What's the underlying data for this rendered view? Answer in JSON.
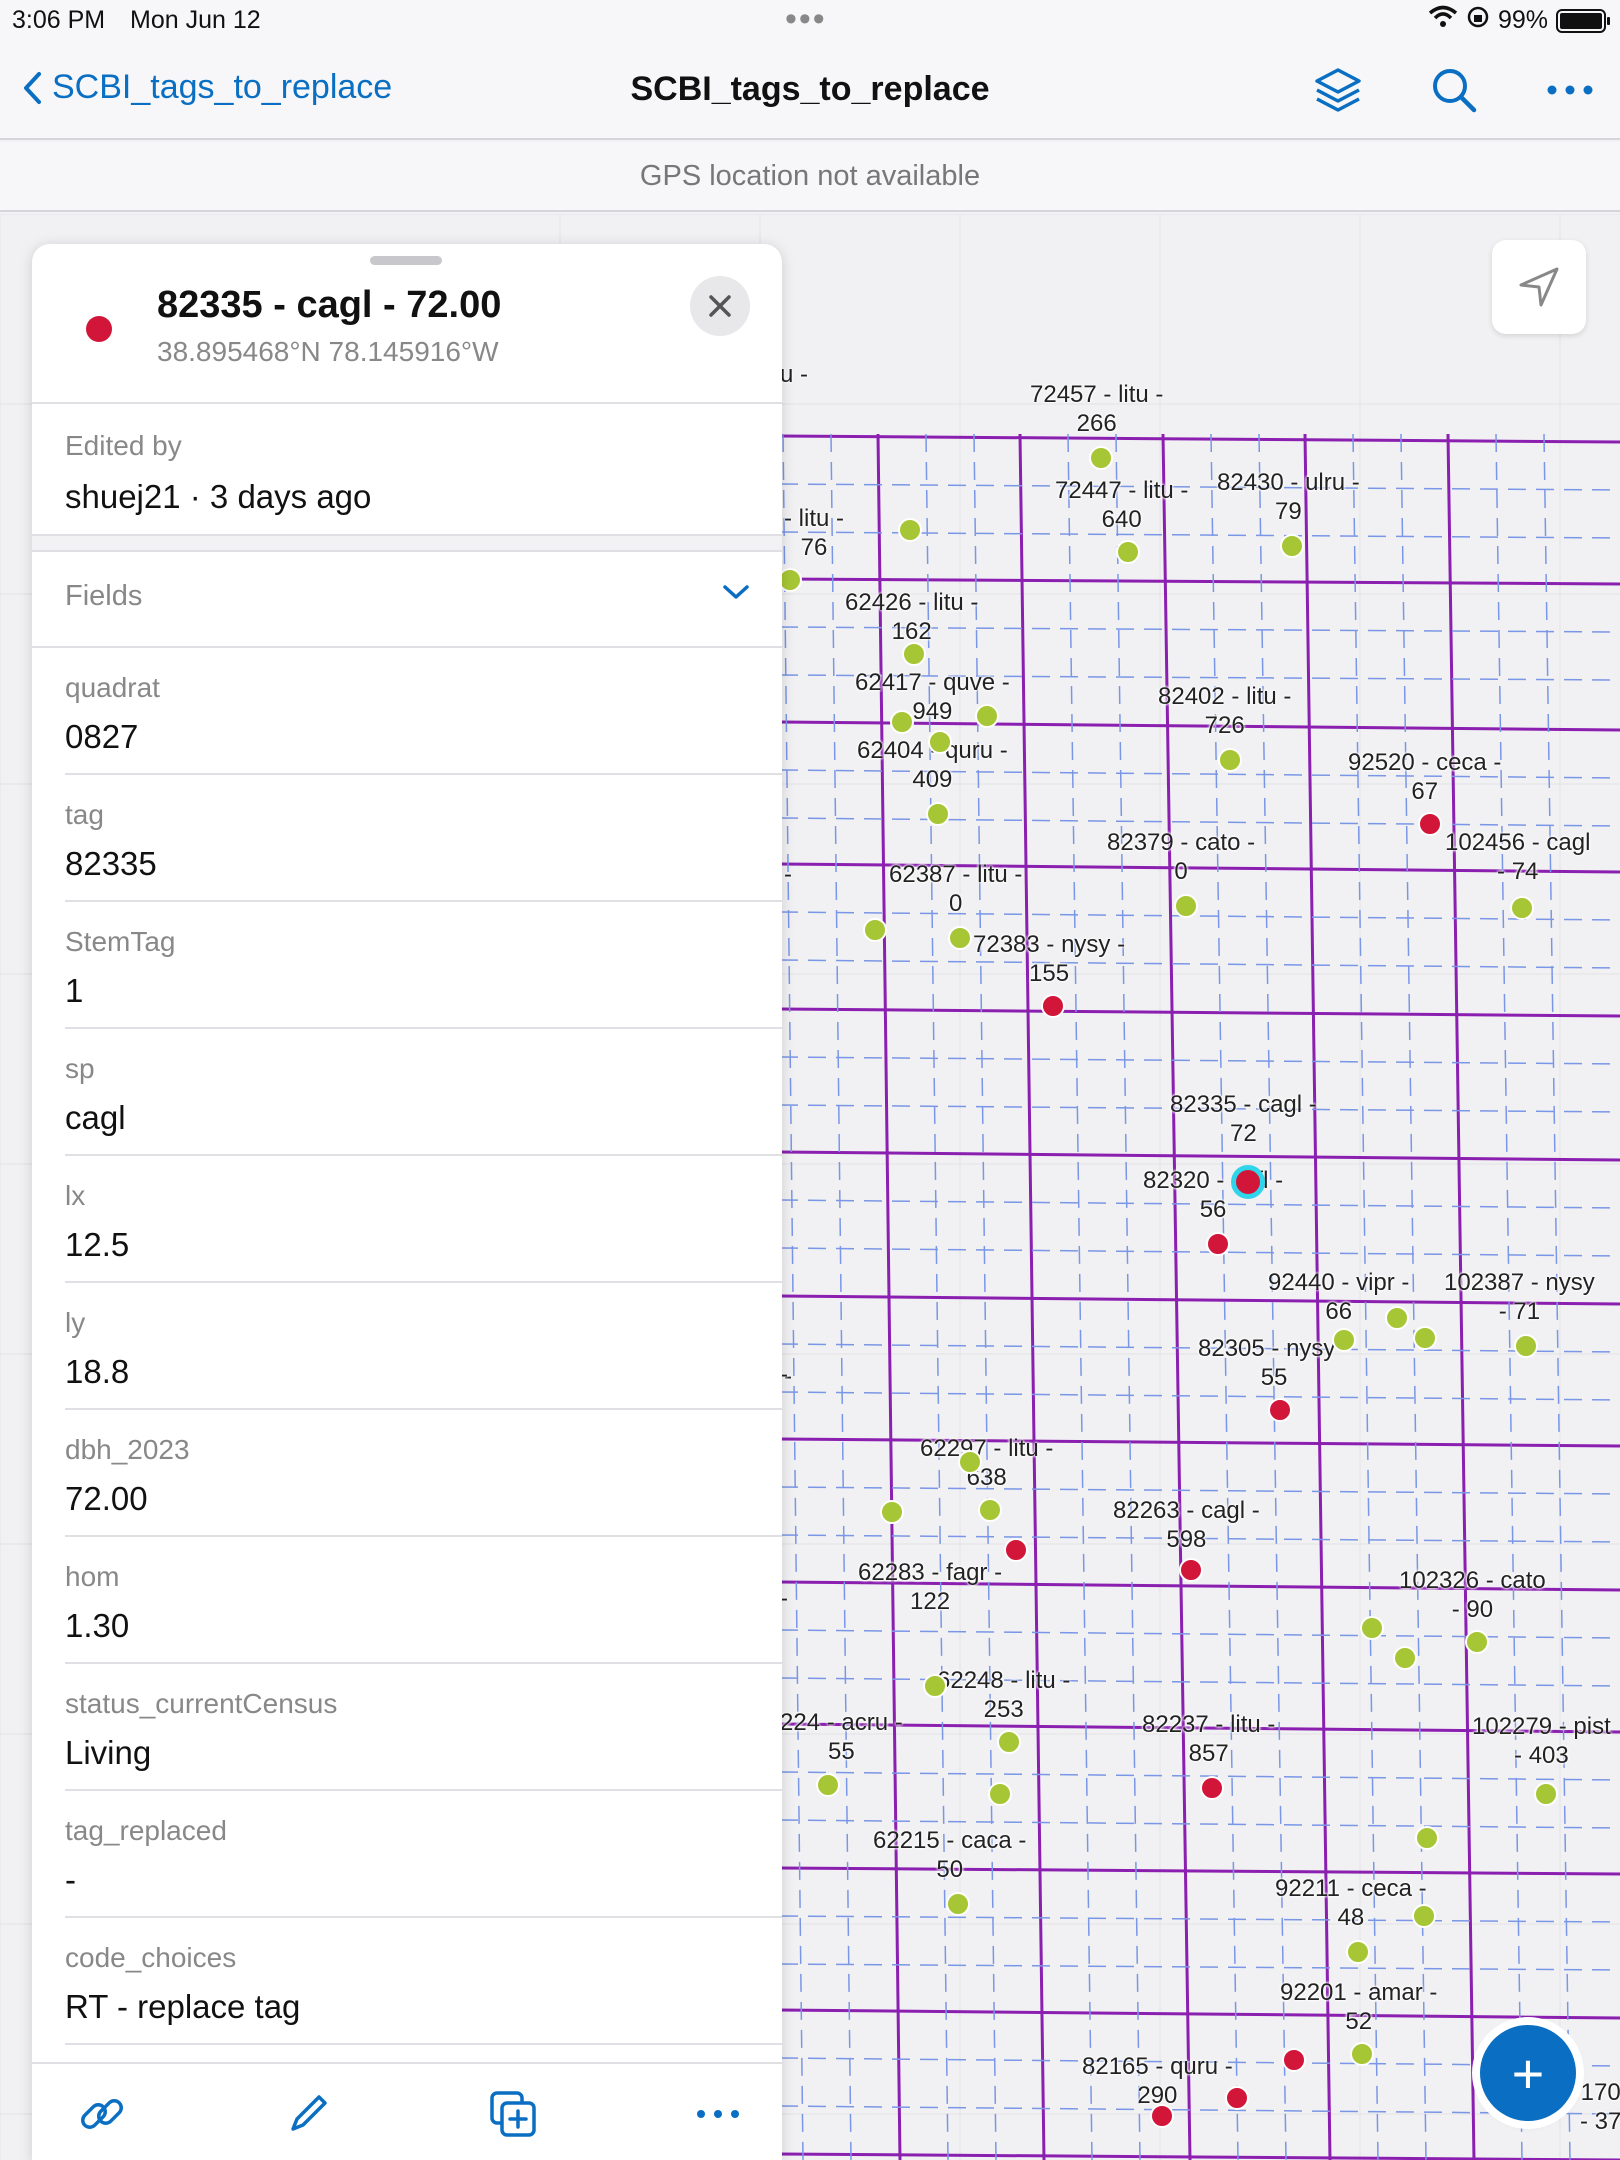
{
  "status": {
    "time": "3:06 PM",
    "date": "Mon Jun 12",
    "battery": "99%"
  },
  "nav": {
    "back_label": "SCBI_tags_to_replace",
    "title": "SCBI_tags_to_replace"
  },
  "gps_message": "GPS location not available",
  "panel": {
    "title": "82335 - cagl - 72.00",
    "coords": "38.895468°N  78.145916°W",
    "edited_label": "Edited by",
    "edited_value": "shuej21 · 3 days ago",
    "fields_label": "Fields",
    "rows": [
      {
        "label": "quadrat",
        "value": "0827"
      },
      {
        "label": "tag",
        "value": "82335"
      },
      {
        "label": "StemTag",
        "value": "1"
      },
      {
        "label": "sp",
        "value": "cagl"
      },
      {
        "label": "lx",
        "value": "12.5"
      },
      {
        "label": "ly",
        "value": "18.8"
      },
      {
        "label": "dbh_2023",
        "value": "72.00"
      },
      {
        "label": "hom",
        "value": "1.30"
      },
      {
        "label": "status_currentCensus",
        "value": "Living"
      },
      {
        "label": "tag_replaced",
        "value": "-"
      },
      {
        "label": "code_choices",
        "value": "RT - replace tag"
      }
    ]
  },
  "map_labels": [
    "u -",
    "72457 - litu -\n266",
    "72447 - litu -\n640",
    "82430 - ulru -\n79",
    "- litu -\n76",
    "62426 - litu -\n162",
    "62417 - quve -\n949",
    "82402 - litu -\n726",
    "62404 - quru -\n409",
    "92520 - ceca -\n67",
    "82379 - cato -\n0",
    "102456 - cagl\n- 74",
    "62387 - litu -\n0",
    "-",
    "72383 - nysy -\n155",
    "82335 - cagl -\n72",
    "82320 - cofl -\n56",
    "92440 - vipr -\n66",
    "102387 - nysy\n- 71",
    "82305 - nysy -\n55",
    "-",
    "62297 - litu -\n638",
    "82263 - cagl -\n598",
    "62283 - fagr -\n122",
    "102326 - cato\n- 90",
    "62248 - litu -\n253",
    "224 - acru -\n55",
    "82237 - litu -\n857",
    "102279 - pist\n- 403",
    "62215 - caca -\n50",
    "92211 - ceca -\n48",
    "92201 - amar -\n52",
    "82165 - quru -\n290",
    "170\n- 37",
    "-",
    "-"
  ],
  "colors": {
    "accent": "#0a6fc2",
    "red_point": "#d2163a",
    "green_point": "#a7c635",
    "grid_purple": "#8a1fb0",
    "grid_blue": "#7a96e6"
  }
}
